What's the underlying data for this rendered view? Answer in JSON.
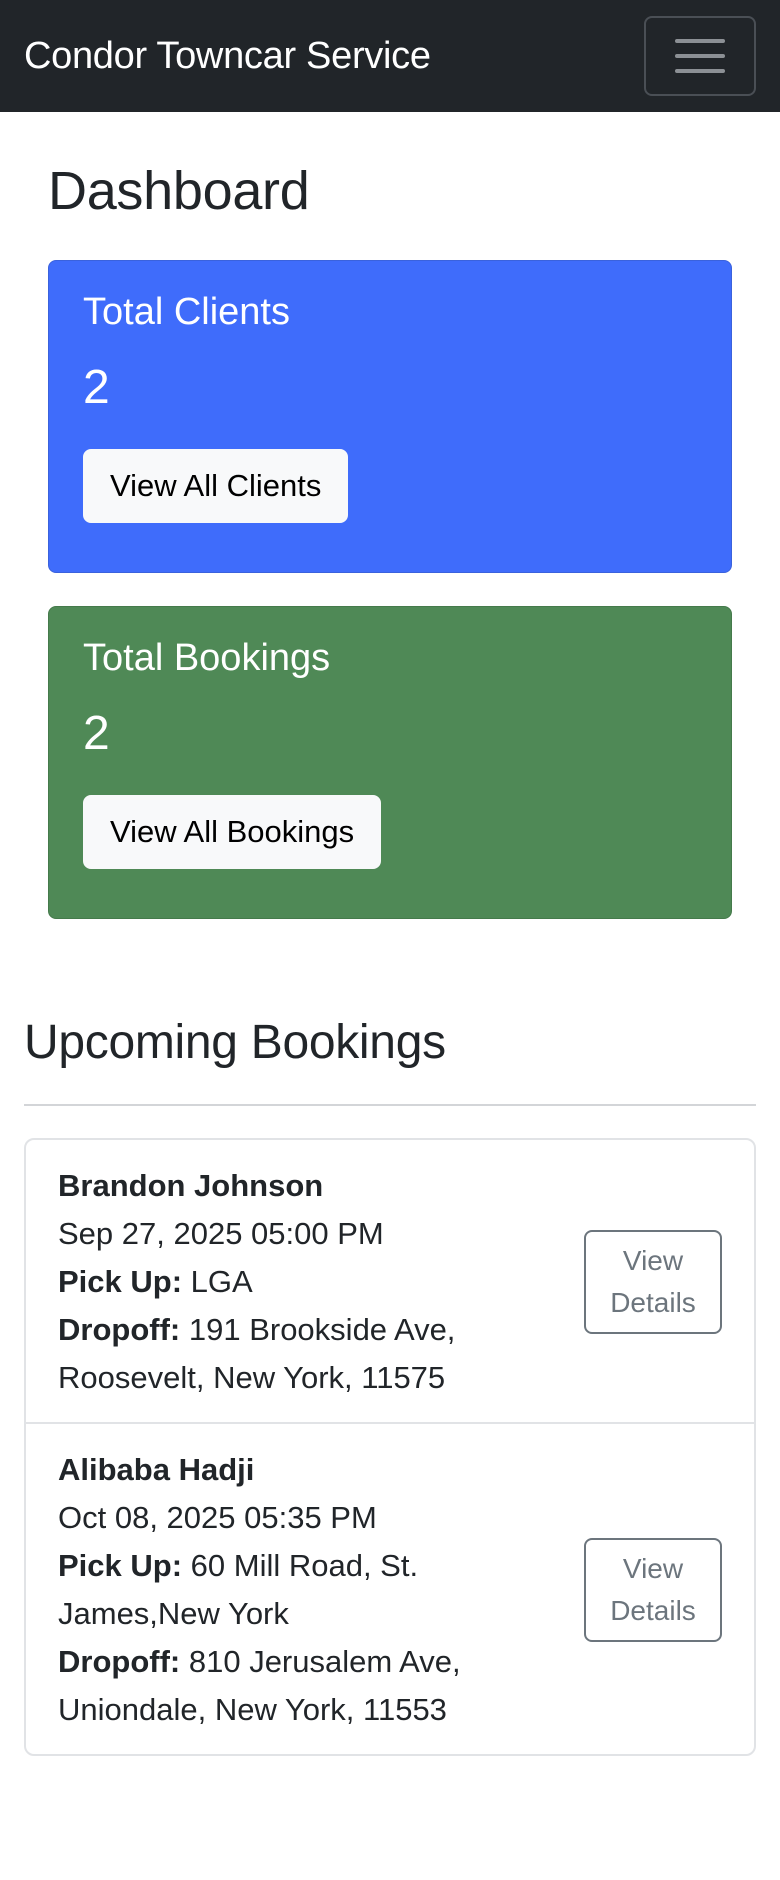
{
  "navbar": {
    "brand": "Condor Towncar Service",
    "toggler_icon": "hamburger-menu-icon"
  },
  "dashboard": {
    "title": "Dashboard",
    "cards": [
      {
        "title": "Total Clients",
        "value": "2",
        "button_label": "View All Clients",
        "color": "#3f6cfb"
      },
      {
        "title": "Total Bookings",
        "value": "2",
        "button_label": "View All Bookings",
        "color": "#4f8956"
      }
    ]
  },
  "upcoming": {
    "title": "Upcoming Bookings",
    "pickup_label": "Pick Up:",
    "dropoff_label": "Dropoff:",
    "button_label": "View Details",
    "items": [
      {
        "client": "Brandon Johnson",
        "datetime": "Sep 27, 2025 05:00 PM",
        "pickup": "LGA",
        "dropoff": "191 Brookside Ave, Roosevelt, New York, 11575"
      },
      {
        "client": "Alibaba Hadji",
        "datetime": "Oct 08, 2025 05:35 PM",
        "pickup": "60 Mill Road, St. James,New York",
        "dropoff": "810 Jerusalem Ave, Uniondale, New York, 11553"
      }
    ]
  }
}
